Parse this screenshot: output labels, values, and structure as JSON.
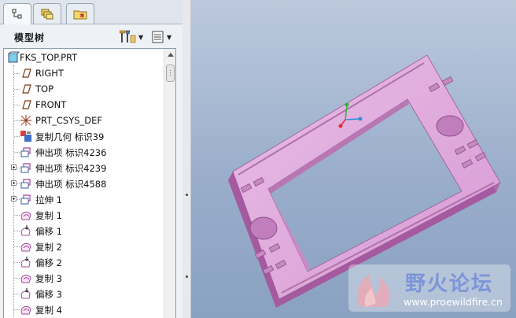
{
  "tabs": [
    {
      "name": "model-tree-tab",
      "icon": "model-tree-icon",
      "active": true
    },
    {
      "name": "layers-tab",
      "icon": "layers-icon",
      "active": false
    },
    {
      "name": "favorites-tab",
      "icon": "favorites-folder-icon",
      "active": false
    }
  ],
  "panel": {
    "title": "模型树",
    "settings_icon": "tree-settings-icon",
    "show_icon": "tree-show-icon"
  },
  "tree": {
    "items": [
      {
        "label": "FKS_TOP.PRT",
        "icon": "part-icon",
        "level": 0,
        "expandable": false
      },
      {
        "label": "RIGHT",
        "icon": "datum-plane-icon",
        "level": 1,
        "expandable": false
      },
      {
        "label": "TOP",
        "icon": "datum-plane-icon",
        "level": 1,
        "expandable": false
      },
      {
        "label": "FRONT",
        "icon": "datum-plane-icon",
        "level": 1,
        "expandable": false
      },
      {
        "label": "PRT_CSYS_DEF",
        "icon": "csys-icon",
        "level": 1,
        "expandable": false
      },
      {
        "label": "复制几何 标识39",
        "icon": "copy-geometry-icon",
        "level": 1,
        "expandable": false
      },
      {
        "label": "伸出项 标识4236",
        "icon": "protrusion-icon",
        "level": 1,
        "expandable": false
      },
      {
        "label": "伸出项 标识4239",
        "icon": "protrusion-icon",
        "level": 1,
        "expandable": true
      },
      {
        "label": "伸出项 标识4588",
        "icon": "protrusion-icon",
        "level": 1,
        "expandable": true
      },
      {
        "label": "拉伸 1",
        "icon": "extrude-icon",
        "level": 1,
        "expandable": true
      },
      {
        "label": "复制 1",
        "icon": "copy-surface-icon",
        "level": 1,
        "expandable": false
      },
      {
        "label": "偏移 1",
        "icon": "offset-icon",
        "level": 1,
        "expandable": false
      },
      {
        "label": "复制 2",
        "icon": "copy-surface-icon",
        "level": 1,
        "expandable": false
      },
      {
        "label": "偏移 2",
        "icon": "offset-icon",
        "level": 1,
        "expandable": false
      },
      {
        "label": "复制 3",
        "icon": "copy-surface-icon",
        "level": 1,
        "expandable": false
      },
      {
        "label": "偏移 3",
        "icon": "offset-icon",
        "level": 1,
        "expandable": false
      },
      {
        "label": "复制 4",
        "icon": "copy-surface-icon",
        "level": 1,
        "expandable": false
      }
    ]
  },
  "viewport": {
    "model_color": "#d9a3d6",
    "background_top": "#bcc9dd",
    "background_bottom": "#8aa1c1"
  },
  "watermark": {
    "name": "野火论坛",
    "url": "www.proewildfire.cn"
  }
}
